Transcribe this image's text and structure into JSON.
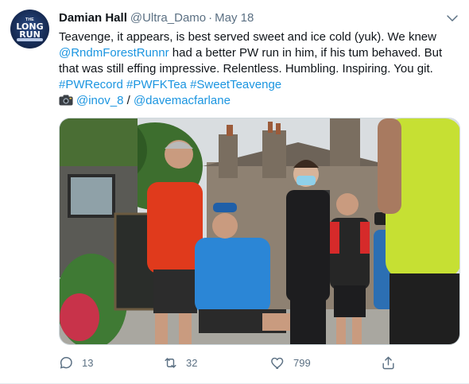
{
  "tweet": {
    "author_name": "Damian Hall",
    "author_handle": "@Ultra_Damo",
    "separator": "·",
    "date": "May 18",
    "avatar": {
      "line1": "THE",
      "line2": "LONG",
      "line3": "RUN"
    },
    "text": {
      "line1": "Teavenge, it appears, is best served sweet and ice cold (yuk). We knew",
      "line2_mention": "@RndmForestRunnr",
      "line2_rest": " had a better PW run in him, if his tum behaved. But",
      "line3": "that was still effing impressive. Relentless. Humbling. Inspiring. You git.",
      "hashtags": [
        "#PWRecord",
        "#PWFKTea",
        "#SweetTeavenge"
      ],
      "credit_1": "@inov_8",
      "credit_sep": " / ",
      "credit_2": "@davemacfarlane"
    },
    "photo_alt": "Runners gathered outside a stone building; a seated runner in a blue top leans back with eyes closed."
  },
  "actions": {
    "reply_count": "13",
    "retweet_count": "32",
    "like_count": "799"
  },
  "icons": {
    "caret": "chevron-down-icon",
    "camera": "camera-icon",
    "reply": "reply-icon",
    "retweet": "retweet-icon",
    "like": "heart-icon",
    "share": "share-icon"
  },
  "colors": {
    "link": "#1b95e0",
    "muted": "#5b7083",
    "text": "#0f1419"
  }
}
